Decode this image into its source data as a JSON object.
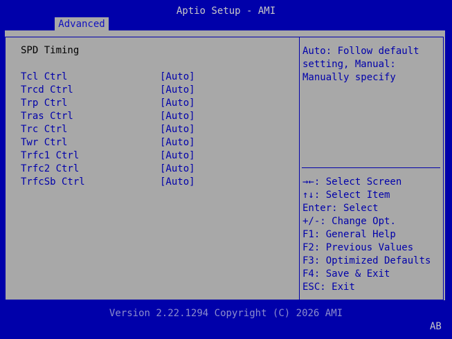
{
  "window": {
    "title": "Aptio Setup - AMI"
  },
  "tabs": [
    {
      "label": "Advanced"
    }
  ],
  "section": {
    "title": "SPD Timing"
  },
  "settings": [
    {
      "label": "Tcl Ctrl",
      "value": "[Auto]"
    },
    {
      "label": "Trcd Ctrl",
      "value": "[Auto]"
    },
    {
      "label": "Trp Ctrl",
      "value": "[Auto]"
    },
    {
      "label": "Tras Ctrl",
      "value": "[Auto]"
    },
    {
      "label": "Trc Ctrl",
      "value": "[Auto]"
    },
    {
      "label": "Twr Ctrl",
      "value": "[Auto]"
    },
    {
      "label": "Trfc1 Ctrl",
      "value": "[Auto]"
    },
    {
      "label": "Trfc2 Ctrl",
      "value": "[Auto]"
    },
    {
      "label": "TrfcSb Ctrl",
      "value": "[Auto]"
    }
  ],
  "help": {
    "text": "Auto: Follow default\nsetting, Manual:\nManually specify"
  },
  "keys": [
    {
      "key": "→←",
      "desc": ": Select Screen"
    },
    {
      "key": "↑↓",
      "desc": ": Select Item"
    },
    {
      "key": "Enter",
      "desc": ": Select"
    },
    {
      "key": "+/-",
      "desc": ": Change Opt."
    },
    {
      "key": "F1",
      "desc": ": General Help"
    },
    {
      "key": "F2",
      "desc": ": Previous Values"
    },
    {
      "key": "F3",
      "desc": ": Optimized Defaults"
    },
    {
      "key": "F4",
      "desc": ": Save & Exit"
    },
    {
      "key": "ESC",
      "desc": ": Exit"
    }
  ],
  "footer": {
    "version": "Version 2.22.1294 Copyright (C) 2026 AMI",
    "badge": "AB"
  },
  "colors": {
    "background": "#0000aa",
    "panel": "#a8a8a8",
    "text": "#0000aa"
  }
}
